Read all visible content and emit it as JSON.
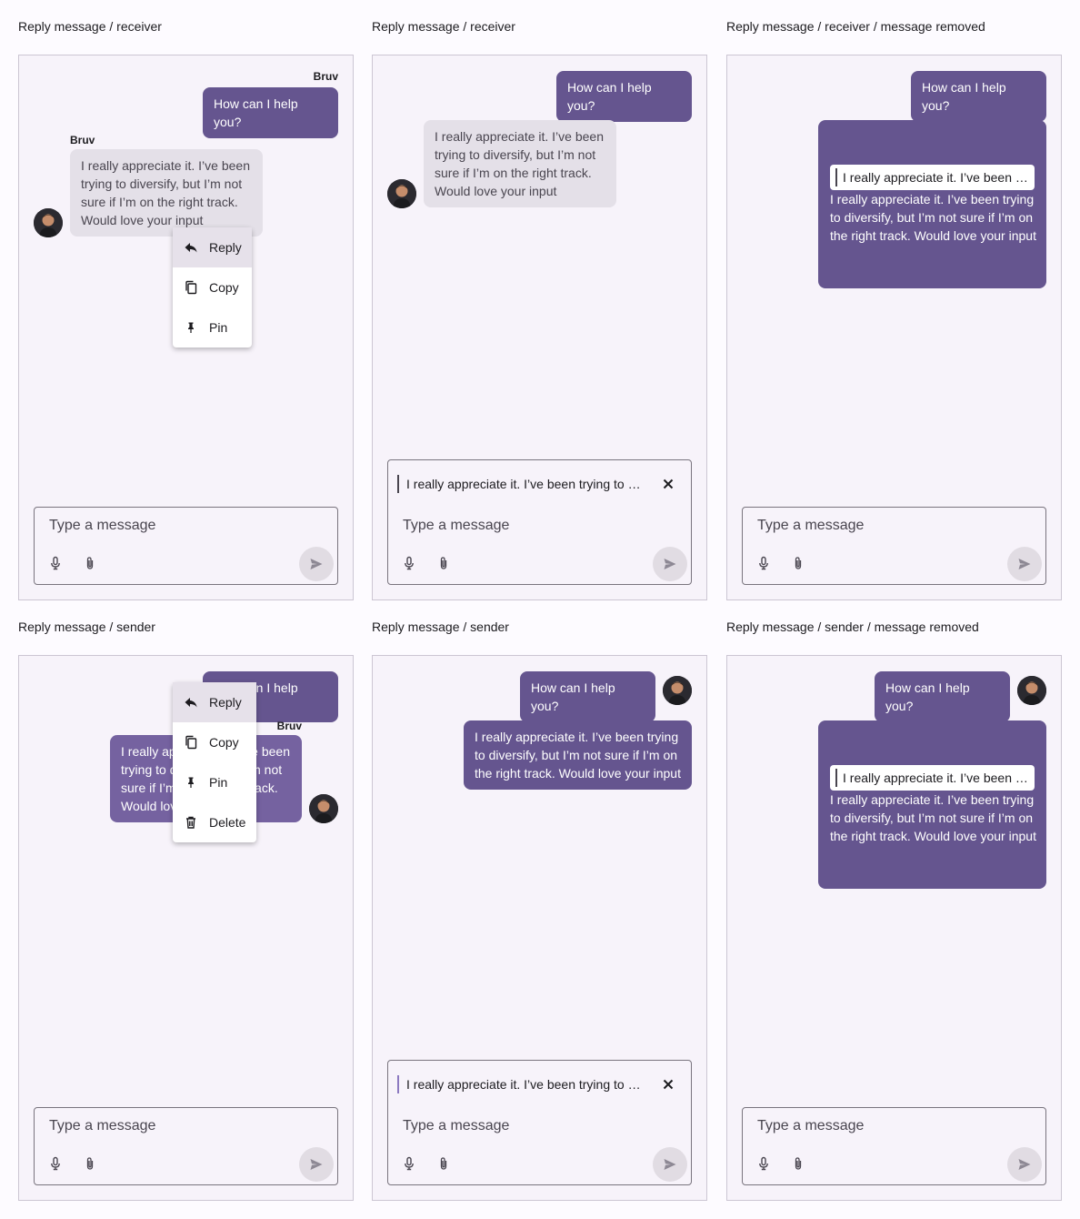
{
  "captions": {
    "p1": "Reply message / receiver",
    "p2": "Reply message / receiver",
    "p3": "Reply message / receiver / message removed",
    "p4": "Reply message / sender",
    "p5": "Reply message / sender",
    "p6": "Reply message / sender / message removed"
  },
  "sender_name": "Bruv",
  "messages": {
    "question": "How can I help you?",
    "answer": "I really appreciate it. I’ve been trying to diversify, but I’m not sure if I’m on the right track. Would love your input"
  },
  "menu": {
    "reply": "Reply",
    "copy": "Copy",
    "pin": "Pin",
    "delete": "Delete"
  },
  "composer": {
    "placeholder": "Type a message"
  },
  "icons": {
    "reply": "reply-icon",
    "copy": "copy-icon",
    "pin": "pin-icon",
    "delete": "trash-icon",
    "mic": "microphone-icon",
    "attach": "paperclip-icon",
    "send": "send-icon",
    "close": "close-icon"
  },
  "colors": {
    "outgoing_bubble": "#65558f",
    "incoming_bubble": "#e4e0e8",
    "panel_bg": "#f7f3fa",
    "menu_highlight": "#e6e1ea"
  }
}
